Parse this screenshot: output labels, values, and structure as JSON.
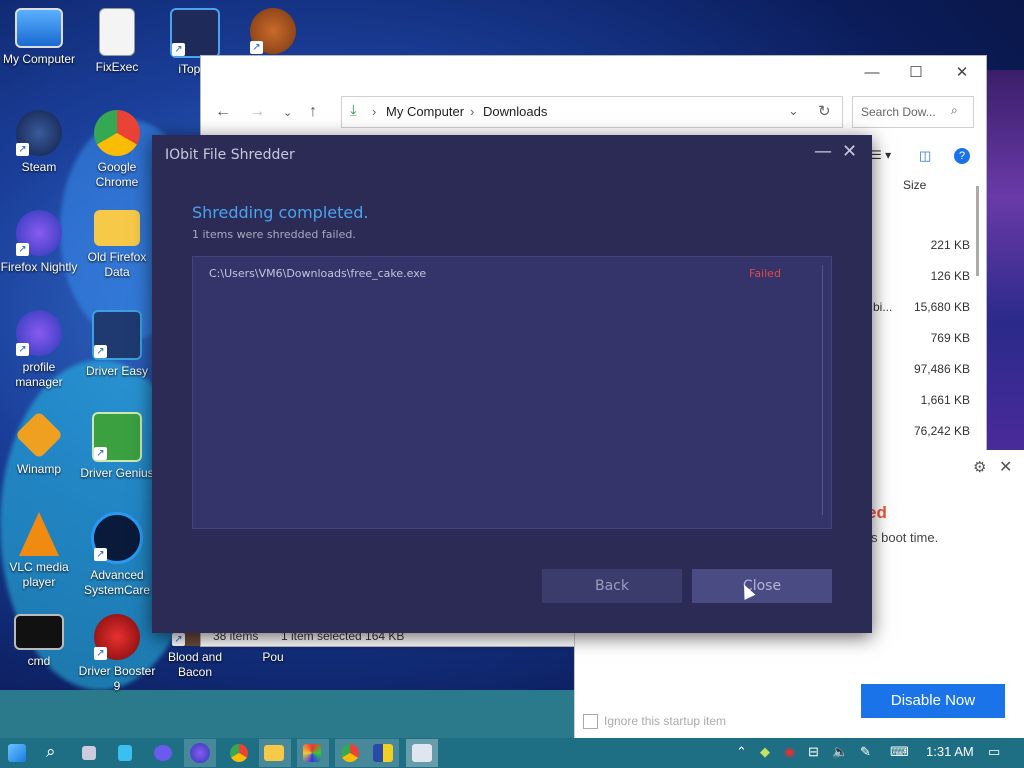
{
  "desktop": {
    "icons": [
      {
        "label": "My Computer"
      },
      {
        "label": "FixExec"
      },
      {
        "label": "iTop V"
      },
      {
        "label": ""
      },
      {
        "label": "Steam"
      },
      {
        "label": "Google Chrome"
      },
      {
        "label": "Firefox Nightly"
      },
      {
        "label": "Old Firefox Data"
      },
      {
        "label": "profile manager"
      },
      {
        "label": "Driver Easy"
      },
      {
        "label": "Winamp"
      },
      {
        "label": "Driver Genius"
      },
      {
        "label": "VLC media player"
      },
      {
        "label": "Advanced SystemCare"
      },
      {
        "label": "cmd"
      },
      {
        "label": "Driver Booster 9"
      },
      {
        "label": "Blood and Bacon"
      },
      {
        "label": "Pou"
      }
    ]
  },
  "explorer": {
    "path": [
      "My Computer",
      "Downloads"
    ],
    "search_placeholder": "Search Dow...",
    "column_size": "Size",
    "sizes": [
      "221 KB",
      "126 KB",
      "15,680 KB",
      "769 KB",
      "97,486 KB",
      "1,661 KB",
      "76,242 KB"
    ],
    "partial_name": "bi...",
    "status_items": "38 items",
    "status_selected": "1 item selected  164 KB"
  },
  "notification": {
    "heading_fragment": "ed",
    "text_fragment": "s boot time.",
    "disable_label": "Disable Now",
    "ignore_label": "Ignore this startup item"
  },
  "shredder": {
    "title": "IObit File Shredder",
    "heading": "Shredding completed.",
    "subtext": "1 items were shredded failed.",
    "rows": [
      {
        "path": "C:\\Users\\VM6\\Downloads\\free_cake.exe",
        "status": "Failed"
      }
    ],
    "back_label": "Back",
    "close_label": "Close"
  },
  "taskbar": {
    "time": "1:31 AM"
  },
  "colors": {
    "accent_blue": "#4aa3ef",
    "failed_red": "#e04848",
    "dialog_bg": "#2b2b55",
    "taskbar": "#1f6f84"
  }
}
